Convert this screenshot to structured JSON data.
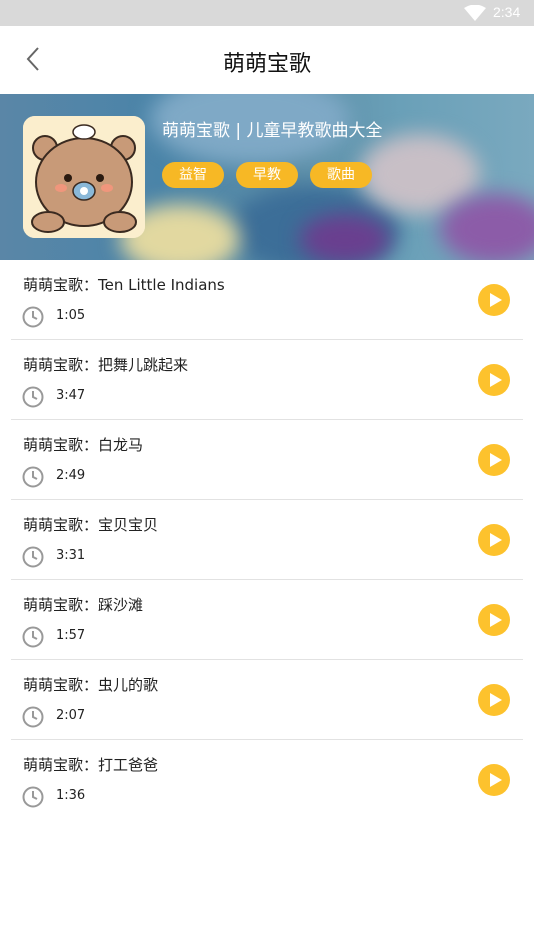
{
  "status_bar": {
    "time": "2:34",
    "icons": [
      "wifi-icon"
    ]
  },
  "header": {
    "title": "萌萌宝歌",
    "back_icon": "chevron-left-icon"
  },
  "album": {
    "title": "萌萌宝歌 | 儿童早教歌曲大全",
    "tags": [
      "益智",
      "早教",
      "歌曲"
    ],
    "cover_icon": "bear-illustration"
  },
  "songs": [
    {
      "title": "萌萌宝歌：Ten Little Indians",
      "duration": "1:05"
    },
    {
      "title": "萌萌宝歌：把舞儿跳起来",
      "duration": "3:47"
    },
    {
      "title": "萌萌宝歌：白龙马",
      "duration": "2:49"
    },
    {
      "title": "萌萌宝歌：宝贝宝贝",
      "duration": "3:31"
    },
    {
      "title": "萌萌宝歌：踩沙滩",
      "duration": "1:57"
    },
    {
      "title": "萌萌宝歌：虫儿的歌",
      "duration": "2:07"
    },
    {
      "title": "萌萌宝歌：打工爸爸",
      "duration": "1:36"
    }
  ],
  "colors": {
    "accent": "#f7b825",
    "play": "#fdc22d",
    "divider": "#e2e2e2"
  }
}
